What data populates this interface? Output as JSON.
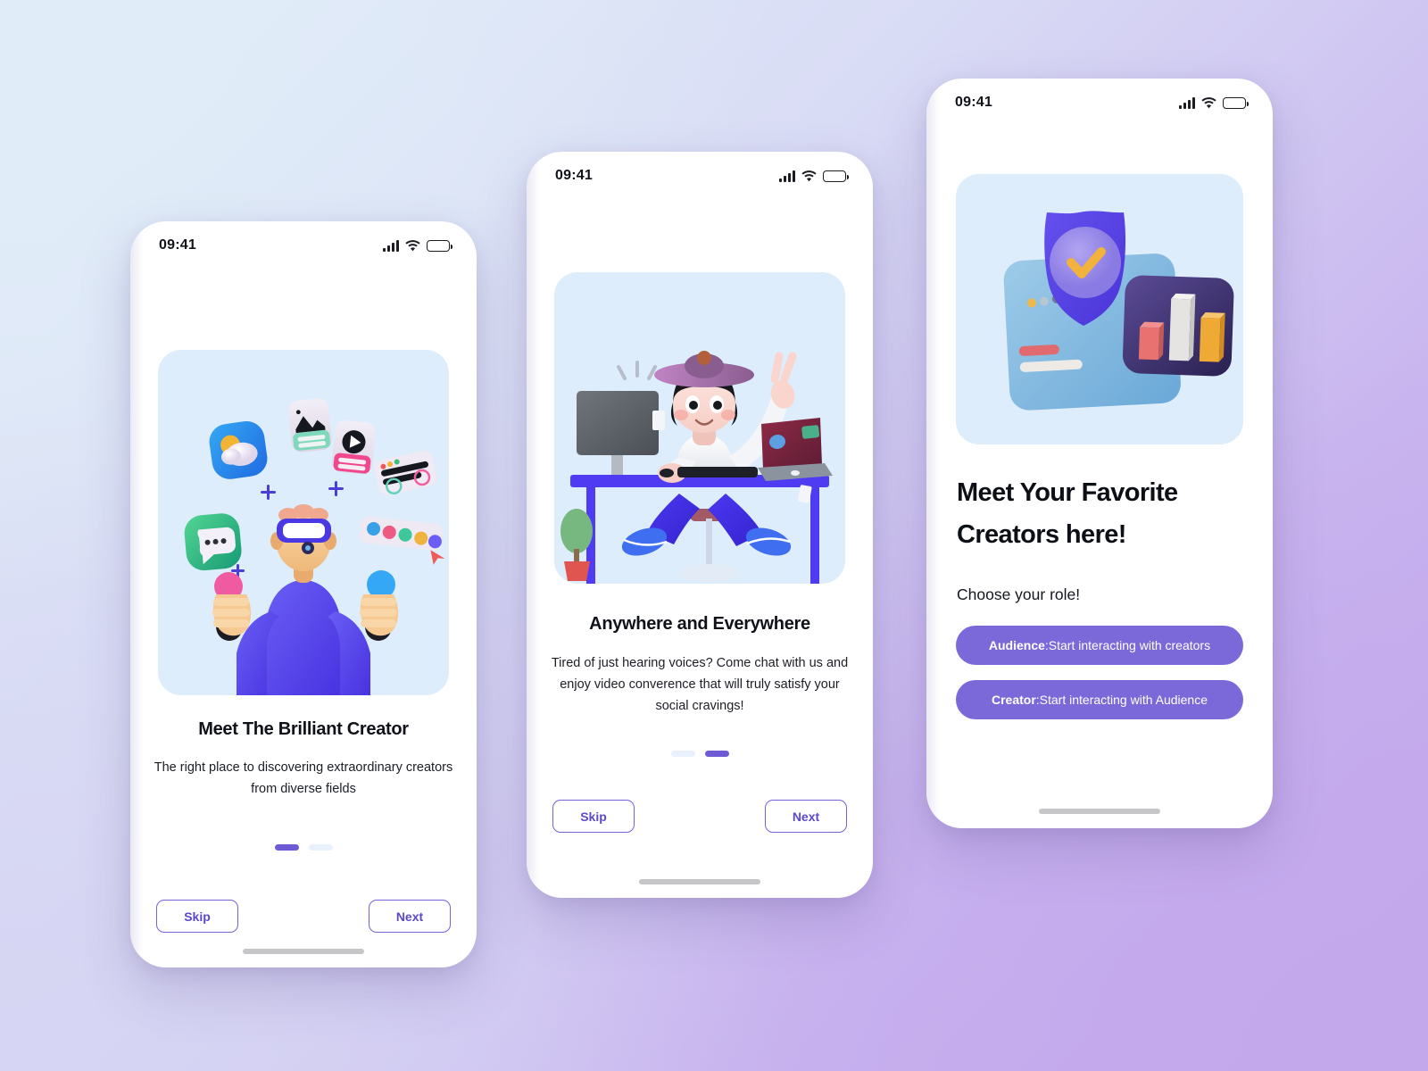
{
  "background": {
    "gradient_from": "#e0edf8",
    "gradient_to": "#c3a6ec"
  },
  "theme": {
    "accent": "#6d5ad4",
    "button_fill": "#7c69d9",
    "outline_border": "#7263d8",
    "outline_text": "#5b49cc",
    "hero_bg": "#ddedfb",
    "dot_inactive": "#e8f1fd",
    "home_indicator": "#c6c6c9",
    "title_color": "#101219"
  },
  "status_bar": {
    "time": "09:41",
    "icons": [
      "signal-icon",
      "wifi-icon",
      "battery-icon"
    ]
  },
  "screens": [
    {
      "id": "onboarding-1",
      "illustration": "vr-creator-illustration",
      "title": "Meet The Brilliant Creator",
      "subtitle": "The right place to discovering extraordinary creators from diverse fields",
      "pagination": {
        "count": 2,
        "active_index": 0
      },
      "buttons": {
        "skip": "Skip",
        "next": "Next"
      }
    },
    {
      "id": "onboarding-2",
      "illustration": "desk-video-chat-illustration",
      "title": "Anywhere and Everywhere",
      "subtitle": "Tired of just hearing voices? Come chat with us and enjoy video converence that will truly satisfy your social cravings!",
      "pagination": {
        "count": 2,
        "active_index": 1
      },
      "buttons": {
        "skip": "Skip",
        "next": "Next"
      }
    },
    {
      "id": "onboarding-3",
      "illustration": "shield-chart-card-illustration",
      "headline_line1": "Meet Your Favorite",
      "headline_line2": "Creators here!",
      "role_prompt": "Choose your role!",
      "roles": [
        {
          "name": "Audience",
          "separator": " : ",
          "description": "Start interacting with creators"
        },
        {
          "name": "Creator",
          "separator": " : ",
          "description": "Start interacting with Audience"
        }
      ]
    }
  ]
}
